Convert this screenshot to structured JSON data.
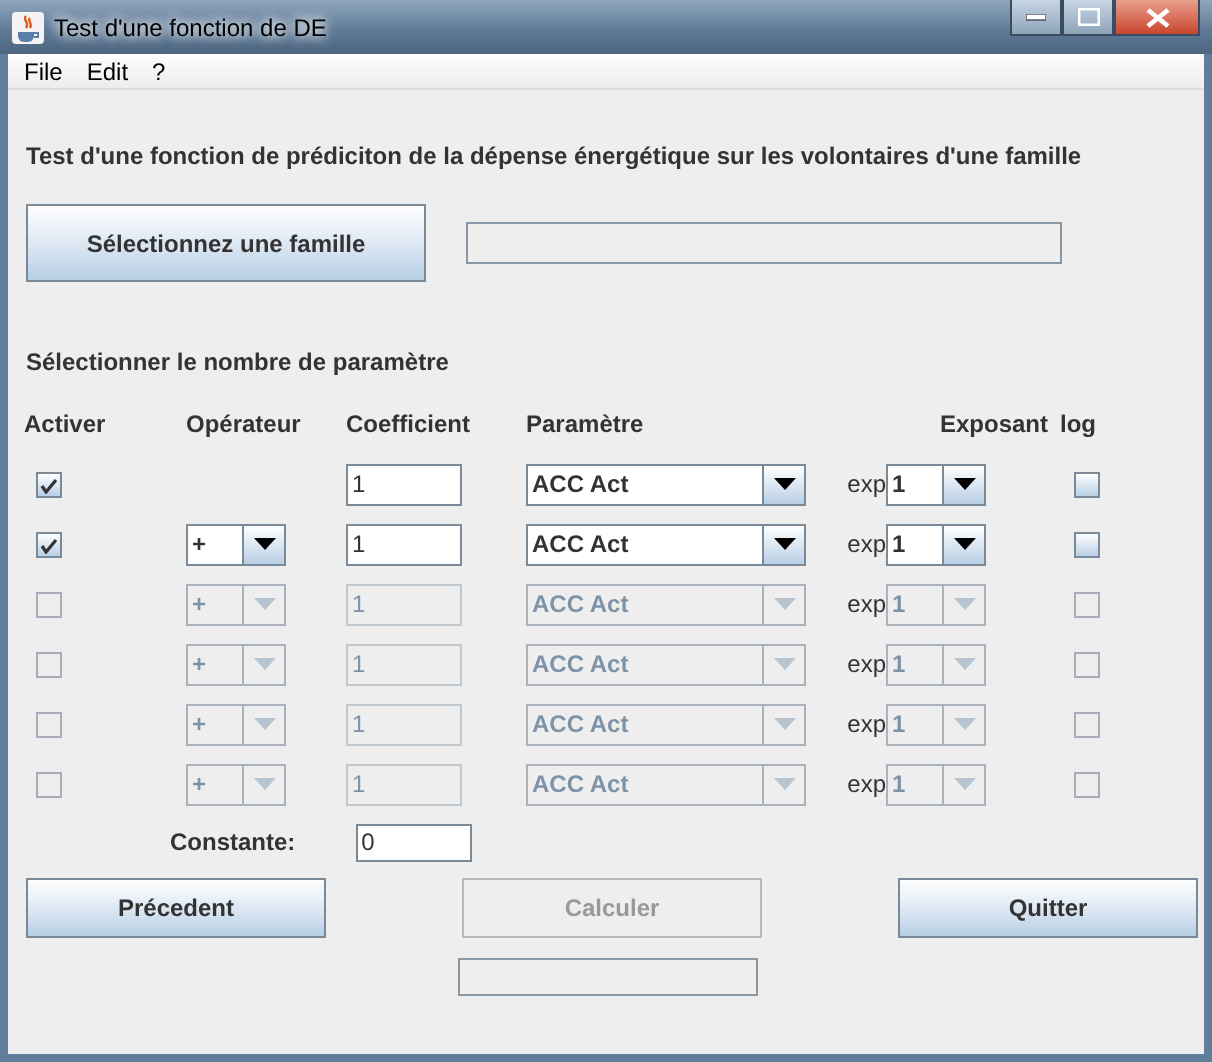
{
  "window": {
    "title": "Test d'une fonction de DE"
  },
  "menu": [
    {
      "label": "File"
    },
    {
      "label": "Edit"
    },
    {
      "label": "?"
    }
  ],
  "heading": "Test d'une fonction de prédiciton de la dépense énergétique sur les volontaires d'une famille",
  "family_button": "Sélectionnez une famille",
  "section_label": "Sélectionner le nombre de paramètre",
  "columns": [
    "Activer",
    "Opérateur",
    "Coefficient",
    "Paramètre",
    "Exposant",
    "log"
  ],
  "rows": [
    {
      "enabled": true,
      "active": true,
      "coefficient": "1",
      "parameter": "ACC Act",
      "exp_label": "exp",
      "exponent": "1",
      "log": false
    },
    {
      "enabled": true,
      "active": true,
      "operator": "+",
      "coefficient": "1",
      "parameter": "ACC Act",
      "exp_label": "exp",
      "exponent": "1",
      "log": false
    },
    {
      "enabled": false,
      "active": false,
      "operator": "+",
      "coefficient": "1",
      "parameter": "ACC Act",
      "exp_label": "exp",
      "exponent": "1",
      "log": false
    },
    {
      "enabled": false,
      "active": false,
      "operator": "+",
      "coefficient": "1",
      "parameter": "ACC Act",
      "exp_label": "exp",
      "exponent": "1",
      "log": false
    },
    {
      "enabled": false,
      "active": false,
      "operator": "+",
      "coefficient": "1",
      "parameter": "ACC Act",
      "exp_label": "exp",
      "exponent": "1",
      "log": false
    },
    {
      "enabled": false,
      "active": false,
      "operator": "+",
      "coefficient": "1",
      "parameter": "ACC Act",
      "exp_label": "exp",
      "exponent": "1",
      "log": false
    }
  ],
  "constant": {
    "label": "Constante:",
    "value": "0"
  },
  "buttons": [
    {
      "label": "Précedent",
      "disabled": false
    },
    {
      "label": "Calculer",
      "disabled": true
    },
    {
      "label": "Quitter",
      "disabled": false
    }
  ]
}
